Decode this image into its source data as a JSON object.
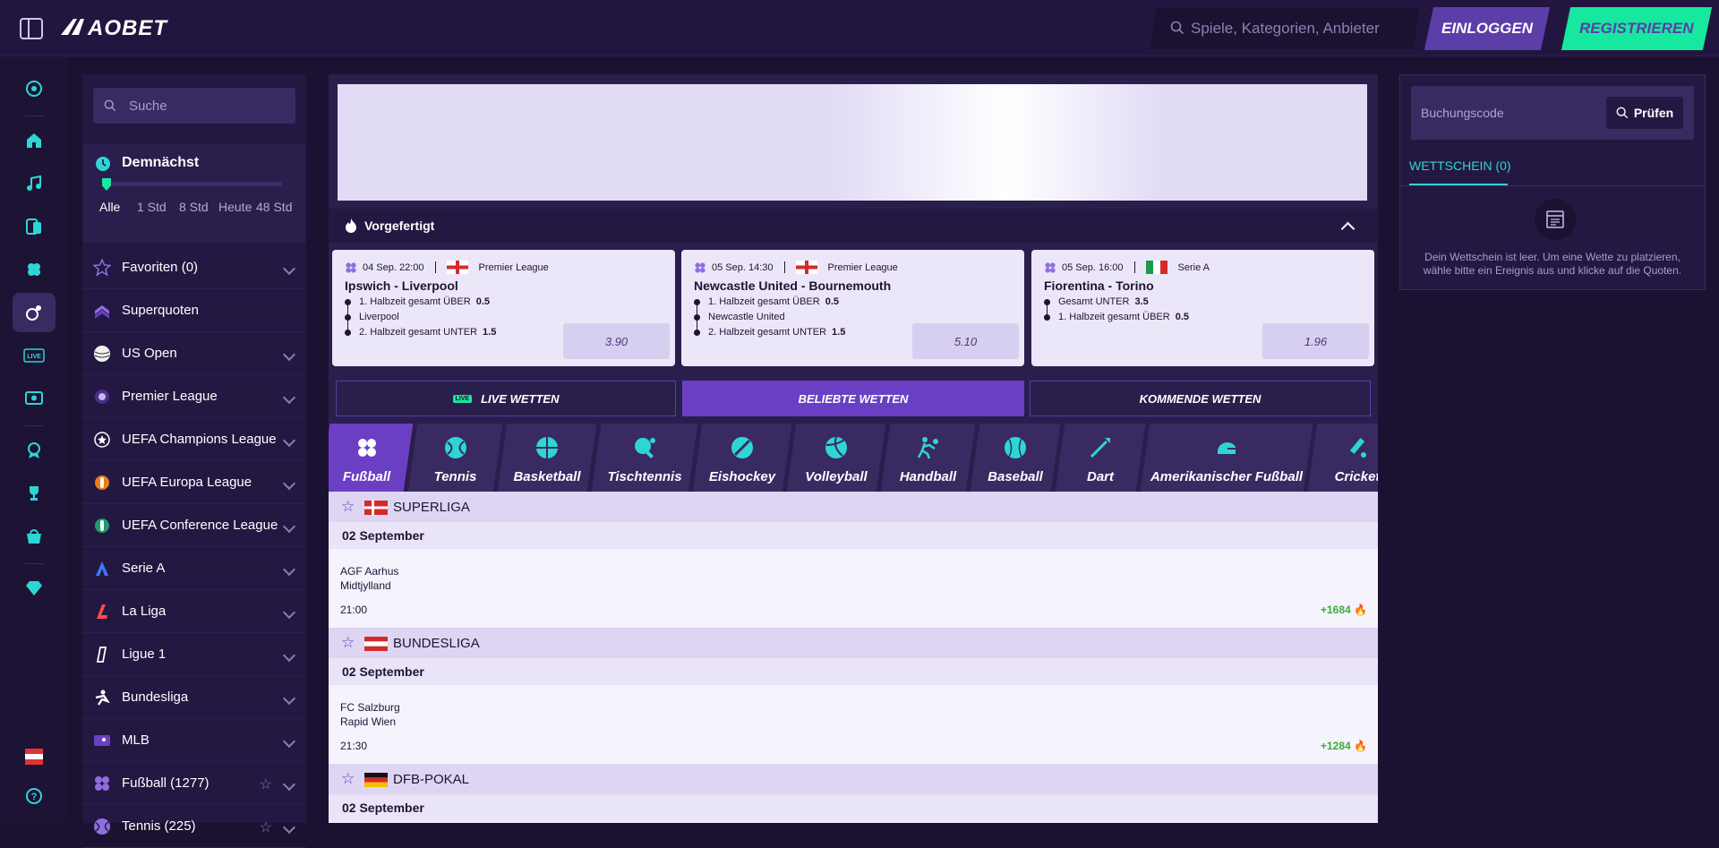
{
  "topbar": {
    "logo": "AOBET",
    "search_placeholder": "Spiele, Kategorien, Anbieter",
    "login_label": "EINLOGGEN",
    "register_label": "REGISTRIEREN",
    "accent_color": "#17e8a0",
    "login_color": "#5b3ea8"
  },
  "rail": {
    "icons": [
      "sports-logo-icon",
      "home-icon",
      "music-icon",
      "casino-icon",
      "clover-icon",
      "sports-icon",
      "live-icon",
      "virtual-icon",
      "rewards-icon",
      "trophy-icon",
      "shop-icon",
      "vip-diamond-icon",
      "language-flag-icon",
      "help-icon"
    ]
  },
  "leftnav": {
    "search_placeholder": "Suche",
    "soon": {
      "title": "Demnächst",
      "options": [
        "Alle",
        "1 Std",
        "8 Std",
        "Heute",
        "48 Std"
      ],
      "selected": "Alle"
    },
    "items": [
      {
        "label": "Favoriten (0)",
        "icon": "star-icon"
      },
      {
        "label": "Superquoten",
        "icon": "superquoten-icon"
      },
      {
        "label": "US Open",
        "icon": "us-open-icon"
      },
      {
        "label": "Premier League",
        "icon": "premier-league-icon"
      },
      {
        "label": "UEFA Champions League",
        "icon": "champions-league-icon"
      },
      {
        "label": "UEFA Europa League",
        "icon": "europa-league-icon"
      },
      {
        "label": "UEFA Conference League",
        "icon": "conference-league-icon"
      },
      {
        "label": "Serie A",
        "icon": "serie-a-icon"
      },
      {
        "label": "La Liga",
        "icon": "la-liga-icon"
      },
      {
        "label": "Ligue 1",
        "icon": "ligue-1-icon"
      },
      {
        "label": "Bundesliga",
        "icon": "bundesliga-icon"
      },
      {
        "label": "MLB",
        "icon": "mlb-icon"
      },
      {
        "label": "Fußball (1277)",
        "icon": "football-icon"
      },
      {
        "label": "Tennis (225)",
        "icon": "tennis-icon"
      }
    ]
  },
  "main": {
    "prebuilt_title": "Vorgefertigt",
    "cards": [
      {
        "datetime": "04 Sep. 22:00",
        "league": "Premier League",
        "title": "Ipswich - Liverpool",
        "selections": [
          {
            "market": "1. Halbzeit gesamt ÜBER",
            "value": "0.5"
          },
          {
            "market": "Liverpool",
            "value": ""
          },
          {
            "market": "2. Halbzeit gesamt UNTER",
            "value": "1.5"
          }
        ],
        "odds": "3.90"
      },
      {
        "datetime": "05 Sep. 14:30",
        "league": "Premier League",
        "title": "Newcastle United - Bournemouth",
        "selections": [
          {
            "market": "1. Halbzeit gesamt ÜBER",
            "value": "0.5"
          },
          {
            "market": "Newcastle United",
            "value": ""
          },
          {
            "market": "2. Halbzeit gesamt UNTER",
            "value": "1.5"
          }
        ],
        "odds": "5.10"
      },
      {
        "datetime": "05 Sep. 16:00",
        "league": "Serie A",
        "title": "Fiorentina - Torino",
        "selections": [
          {
            "market": "Gesamt UNTER",
            "value": "3.5"
          },
          {
            "market": "1. Halbzeit gesamt ÜBER",
            "value": "0.5"
          }
        ],
        "odds": "1.96"
      }
    ],
    "tabs": [
      {
        "label": "LIVE WETTEN",
        "badge": "LIVE"
      },
      {
        "label": "BELIEBTE WETTEN"
      },
      {
        "label": "KOMMENDE WETTEN"
      }
    ],
    "sports": [
      {
        "label": "Fußball"
      },
      {
        "label": "Tennis"
      },
      {
        "label": "Basketball"
      },
      {
        "label": "Tischtennis"
      },
      {
        "label": "Eishockey"
      },
      {
        "label": "Volleyball"
      },
      {
        "label": "Handball"
      },
      {
        "label": "Baseball"
      },
      {
        "label": "Dart"
      },
      {
        "label": "Amerikanischer Fußball"
      },
      {
        "label": "Cricket"
      }
    ],
    "leagues": [
      {
        "name": "SUPERLIGA",
        "date": "02 September",
        "home": "AGF Aarhus",
        "away": "Midtjylland",
        "time": "21:00",
        "more": "+1684"
      },
      {
        "name": "BUNDESLIGA",
        "date": "02 September",
        "home": "FC Salzburg",
        "away": "Rapid Wien",
        "time": "21:30",
        "more": "+1284"
      },
      {
        "name": "DFB-POKAL",
        "date": "02 September"
      }
    ]
  },
  "betslip": {
    "code_placeholder": "Buchungscode",
    "check_label": "Prüfen",
    "tab_label": "WETTSCHEIN (0)",
    "empty_message": "Dein Wettschein ist leer. Um eine Wette zu platzieren, wähle bitte ein Ereignis aus und klicke auf die Quoten."
  }
}
